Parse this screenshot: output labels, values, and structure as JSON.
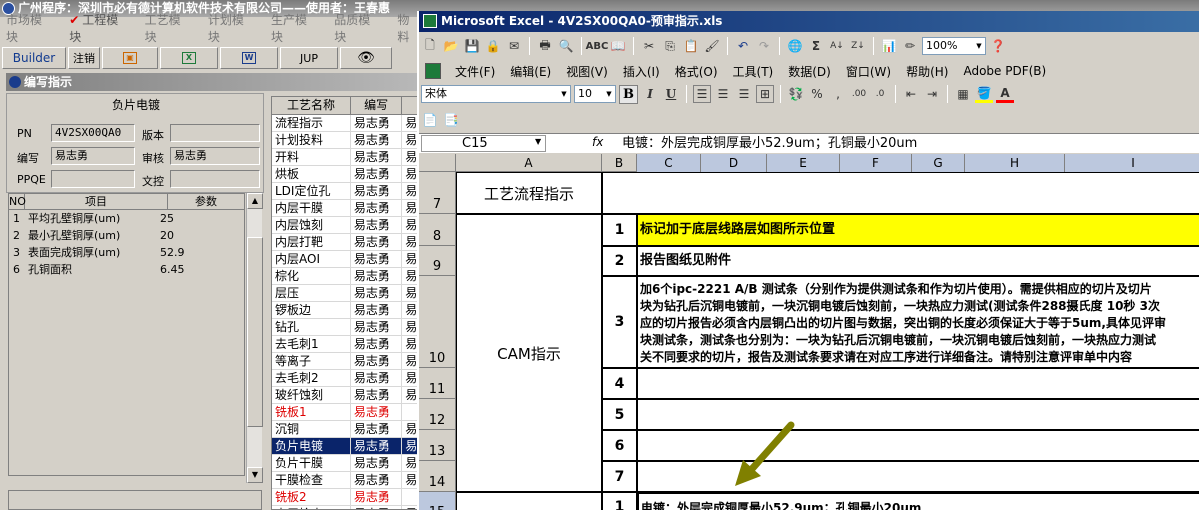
{
  "background_app": {
    "title": "广州程序：深圳市必有德计算机软件技术有限公司——使用者：王春惠",
    "modules": [
      {
        "label": "市场模块",
        "active": false
      },
      {
        "label": "工程模块",
        "active": true
      },
      {
        "label": "工艺模块",
        "active": false
      },
      {
        "label": "计划模块",
        "active": false
      },
      {
        "label": "生产模块",
        "active": false
      },
      {
        "label": "品质模块",
        "active": false
      },
      {
        "label": "物料",
        "active": false
      }
    ],
    "toolbar": {
      "builder": "Builder",
      "logout": "注销",
      "jup": "JUP",
      "w_icon": "W",
      "x_icon": "X"
    },
    "panel_title": "编写指示",
    "doc": {
      "title": "负片电镀",
      "pn_label": "PN",
      "pn_value": "4V2SX00QA0",
      "version_label": "版本",
      "version_value": "",
      "writer_label": "编写",
      "writer_value": "易志勇",
      "review_label": "审核",
      "review_value": "易志勇",
      "ppqe_label": "PPQE",
      "ppqe_value": "",
      "control_label": "文控",
      "control_value": ""
    },
    "params": {
      "headers": [
        "NO",
        "项目",
        "参数"
      ],
      "rows": [
        [
          "1",
          "平均孔壁铜厚(um)",
          "25"
        ],
        [
          "2",
          "最小孔壁铜厚(um)",
          "20"
        ],
        [
          "3",
          "表面完成铜厚(um)",
          "52.9"
        ],
        [
          "6",
          "孔铜面积",
          "6.45"
        ]
      ]
    },
    "process": {
      "headers": [
        "工艺名称",
        "编写",
        ""
      ],
      "rows": [
        {
          "name": "流程指示",
          "writer": "易志勇",
          "extra": "易",
          "state": "normal"
        },
        {
          "name": "计划投料",
          "writer": "易志勇",
          "extra": "易",
          "state": "normal"
        },
        {
          "name": "开料",
          "writer": "易志勇",
          "extra": "易",
          "state": "normal"
        },
        {
          "name": "烘板",
          "writer": "易志勇",
          "extra": "易",
          "state": "normal"
        },
        {
          "name": "LDI定位孔",
          "writer": "易志勇",
          "extra": "易",
          "state": "normal"
        },
        {
          "name": "内层干膜",
          "writer": "易志勇",
          "extra": "易",
          "state": "normal"
        },
        {
          "name": "内层蚀刻",
          "writer": "易志勇",
          "extra": "易",
          "state": "normal"
        },
        {
          "name": "内层打靶",
          "writer": "易志勇",
          "extra": "易",
          "state": "normal"
        },
        {
          "name": "内层AOI",
          "writer": "易志勇",
          "extra": "易",
          "state": "normal"
        },
        {
          "name": "棕化",
          "writer": "易志勇",
          "extra": "易",
          "state": "normal"
        },
        {
          "name": "层压",
          "writer": "易志勇",
          "extra": "易",
          "state": "normal"
        },
        {
          "name": "锣板边",
          "writer": "易志勇",
          "extra": "易",
          "state": "normal"
        },
        {
          "name": "钻孔",
          "writer": "易志勇",
          "extra": "易",
          "state": "normal"
        },
        {
          "name": "去毛刺1",
          "writer": "易志勇",
          "extra": "易",
          "state": "normal"
        },
        {
          "name": "等离子",
          "writer": "易志勇",
          "extra": "易",
          "state": "normal"
        },
        {
          "name": "去毛刺2",
          "writer": "易志勇",
          "extra": "易",
          "state": "normal"
        },
        {
          "name": "玻纤蚀刻",
          "writer": "易志勇",
          "extra": "易",
          "state": "normal"
        },
        {
          "name": "铣板1",
          "writer": "易志勇",
          "extra": "",
          "state": "red"
        },
        {
          "name": "沉铜",
          "writer": "易志勇",
          "extra": "易",
          "state": "normal"
        },
        {
          "name": "负片电镀",
          "writer": "易志勇",
          "extra": "易",
          "state": "selected"
        },
        {
          "name": "负片干膜",
          "writer": "易志勇",
          "extra": "易",
          "state": "normal"
        },
        {
          "name": "干膜检查",
          "writer": "易志勇",
          "extra": "易",
          "state": "normal"
        },
        {
          "name": "铣板2",
          "writer": "易志勇",
          "extra": "",
          "state": "red"
        },
        {
          "name": "内层检查",
          "writer": "易志勇",
          "extra": "易",
          "state": "normal"
        }
      ]
    }
  },
  "excel": {
    "title": "Microsoft Excel - 4V2SX00QA0-预审指示.xls",
    "zoom": "100%",
    "menus": [
      "文件(F)",
      "编辑(E)",
      "视图(V)",
      "插入(I)",
      "格式(O)",
      "工具(T)",
      "数据(D)",
      "窗口(W)",
      "帮助(H)",
      "Adobe PDF(B)"
    ],
    "font_name": "宋体",
    "font_size": "10",
    "name_box": "C15",
    "fx_label": "fx",
    "formula": "电镀：外层完成铜厚最小52.9um；孔铜最小20um",
    "columns": [
      "A",
      "B",
      "C",
      "D",
      "E",
      "F",
      "G",
      "H",
      "I"
    ],
    "rows": {
      "r7": {
        "num": "7",
        "a": "工艺流程指示"
      },
      "r8": {
        "num": "8",
        "b": "1",
        "c": "标记加于底层线路层如图所示位置"
      },
      "r9": {
        "num": "9",
        "b": "2",
        "c": "报告图纸见附件"
      },
      "r10": {
        "num": "10",
        "a": "CAM指示",
        "b": "3",
        "c_lines": [
          "加6个ipc-2221 A/B 测试条（分别作为提供测试条和作为切片使用）。需提供相应的切片及切片",
          "块为钻孔后沉铜电镀前，一块沉铜电镀后蚀刻前，一块热应力测试(测试条件288摄氏度 10秒 3次",
          "应的切片报告必须含内层铜凸出的切片图与数据，突出铜的长度必须保证大于等于5um,具体见评审",
          "块测试条，测试条也分别为：一块为钻孔后沉铜电镀前，一块沉铜电镀后蚀刻前，一块热应力测试",
          "关不同要求的切片，报告及测试条要求请在对应工序进行详细备注。请特别注意评审单中内容"
        ]
      },
      "r11": {
        "num": "11",
        "b": "4"
      },
      "r12": {
        "num": "12",
        "b": "5"
      },
      "r13": {
        "num": "13",
        "b": "6"
      },
      "r14": {
        "num": "14",
        "b": "7"
      },
      "r15": {
        "num": "15",
        "b": "1",
        "c": "电镀：外层完成铜厚最小52.9um；孔铜最小20um"
      }
    },
    "highlight_color": "#ffff00",
    "arrow_color": "#808000"
  }
}
